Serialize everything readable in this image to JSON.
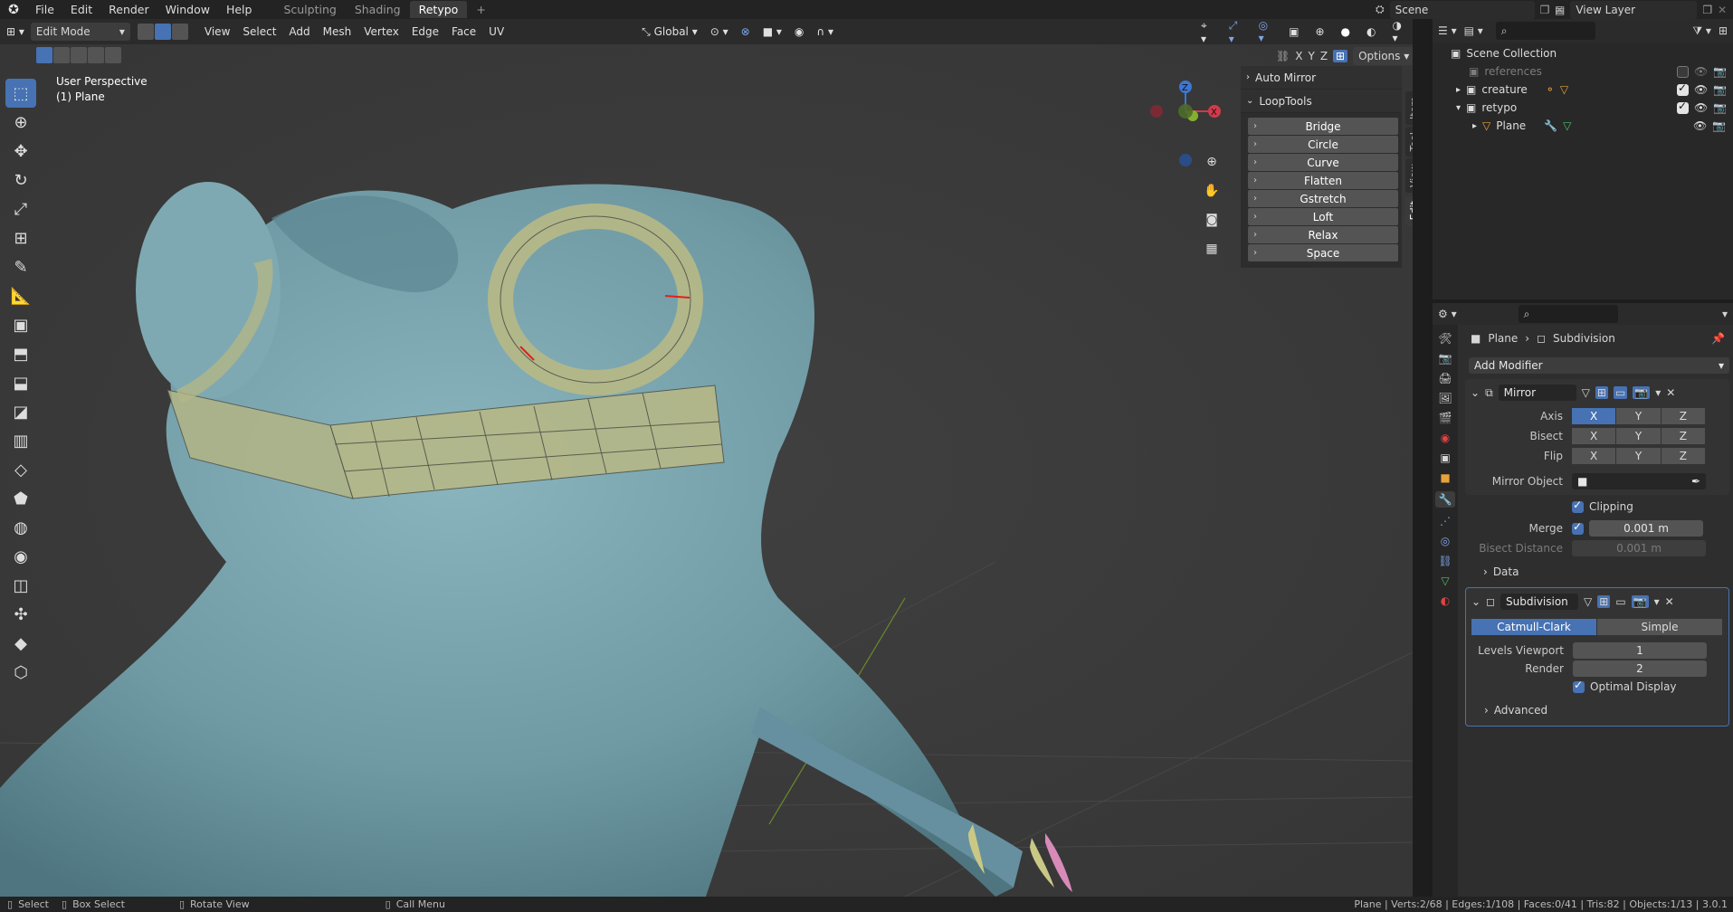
{
  "topbar": {
    "menus": [
      "File",
      "Edit",
      "Render",
      "Window",
      "Help"
    ],
    "workspaces": [
      "Sculpting",
      "Shading",
      "Retypo"
    ],
    "active_workspace": "Retypo",
    "add_label": "+",
    "scene_label": "Scene",
    "viewlayer_label": "View Layer"
  },
  "viewport_header": {
    "mode": "Edit Mode",
    "menus": [
      "View",
      "Select",
      "Add",
      "Mesh",
      "Vertex",
      "Edge",
      "Face",
      "UV"
    ],
    "orientation": "Global",
    "options_label": "Options",
    "axis_labels": [
      "X",
      "Y",
      "Z"
    ]
  },
  "viewport": {
    "view_name": "User Perspective",
    "object_name": "(1) Plane",
    "body_color": "#6f9aa4",
    "bg_color": "#3a3a3a"
  },
  "npanel": {
    "auto_mirror": "Auto Mirror",
    "looptools": "LoopTools",
    "buttons": [
      "Bridge",
      "Circle",
      "Curve",
      "Flatten",
      "Gstretch",
      "Loft",
      "Relax",
      "Space"
    ],
    "tabs": [
      "Item",
      "Tool",
      "View",
      "Edit"
    ]
  },
  "outliner": {
    "collection": "Scene Collection",
    "rows": [
      {
        "name": "references",
        "dim": true
      },
      {
        "name": "creature",
        "dim": false
      },
      {
        "name": "retypo",
        "dim": false
      },
      {
        "name": "Plane",
        "dim": false
      }
    ]
  },
  "properties": {
    "breadcrumb_object": "Plane",
    "breadcrumb_modifier": "Subdivision",
    "add_modifier": "Add Modifier",
    "mirror": {
      "name": "Mirror",
      "axis_label": "Axis",
      "bisect_label": "Bisect",
      "flip_label": "Flip",
      "axes": [
        "X",
        "Y",
        "Z"
      ],
      "axis_active": "X",
      "mirror_object_label": "Mirror Object",
      "clipping_label": "Clipping",
      "clipping": true,
      "merge_label": "Merge",
      "merge": true,
      "merge_value": "0.001 m",
      "bisect_distance_label": "Bisect Distance",
      "bisect_distance_value": "0.001 m",
      "data_label": "Data"
    },
    "subdivision": {
      "name": "Subdivision",
      "mode_catmull": "Catmull-Clark",
      "mode_simple": "Simple",
      "levels_viewport_label": "Levels Viewport",
      "levels_viewport": "1",
      "render_label": "Render",
      "render": "2",
      "optimal_display_label": "Optimal Display",
      "optimal_display": true,
      "advanced_label": "Advanced"
    }
  },
  "status": {
    "select": "Select",
    "box_select": "Box Select",
    "rotate_view": "Rotate View",
    "call_menu": "Call Menu",
    "stats": "Plane | Verts:2/68 | Edges:1/108 | Faces:0/41 | Tris:82 | Objects:1/13 | 3.0.1"
  }
}
